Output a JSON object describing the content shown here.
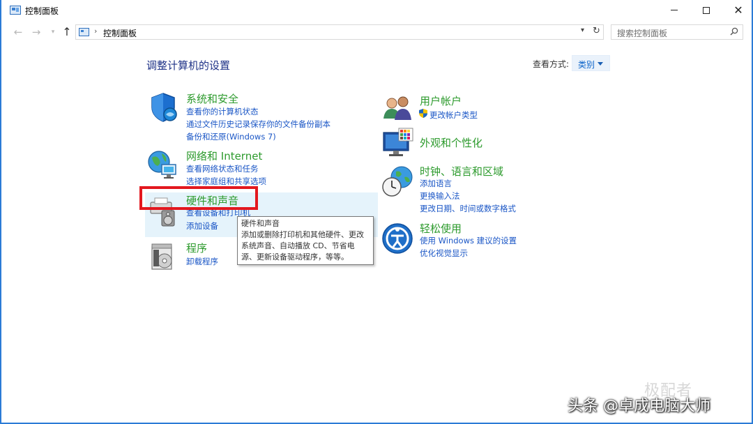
{
  "window": {
    "title": "控制面板",
    "minimize_label": "",
    "maximize_label": "",
    "close_label": "✕"
  },
  "nav": {
    "back_icon": "←",
    "forward_icon": "→",
    "recent_icon": "▾",
    "up_icon": "↑",
    "separator": "›",
    "address": "控制面板",
    "address_dropdown_icon": "▾",
    "refresh_icon": "↻",
    "search_placeholder": "搜索控制面板"
  },
  "main": {
    "heading": "调整计算机的设置",
    "view_by_label": "查看方式:",
    "view_by_value": "类别"
  },
  "categories_left": [
    {
      "title": "系统和安全",
      "icon": "shield-icon",
      "links": [
        "查看你的计算机状态",
        "通过文件历史记录保存你的文件备份副本",
        "备份和还原(Windows 7)"
      ]
    },
    {
      "title": "网络和 Internet",
      "icon": "network-globe-icon",
      "links": [
        "查看网络状态和任务",
        "选择家庭组和共享选项"
      ]
    },
    {
      "title": "硬件和声音",
      "icon": "printer-speaker-icon",
      "links": [
        "查看设备和打印机",
        "添加设备"
      ]
    },
    {
      "title": "程序",
      "icon": "programs-disc-icon",
      "links": [
        "卸载程序"
      ]
    }
  ],
  "categories_right": [
    {
      "title": "用户帐户",
      "icon": "users-icon",
      "links": [
        "更改帐户类型"
      ]
    },
    {
      "title": "外观和个性化",
      "icon": "monitor-palette-icon",
      "links": []
    },
    {
      "title": "时钟、语言和区域",
      "icon": "clock-globe-icon",
      "links": [
        "添加语言",
        "更换输入法",
        "更改日期、时间或数字格式"
      ]
    },
    {
      "title": "轻松使用",
      "icon": "ease-of-access-icon",
      "links": [
        "使用 Windows 建议的设置",
        "优化视觉显示"
      ]
    }
  ],
  "tooltip": {
    "lines": [
      "硬件和声音",
      "添加或删除打印机和其他硬件、更改",
      "系统声音、自动播放 CD、节省电",
      "源、更新设备驱动程序，等等。"
    ]
  },
  "watermarks": {
    "brand": "极配者",
    "caption": "头条 @卓成电脑大师"
  },
  "colors": {
    "category_title": "#2c9a2c",
    "link": "#1a56c6",
    "heading": "#1e3287",
    "highlight_box": "#e3171e",
    "hover_background": "#e5f3fb",
    "window_border": "#2b7bd6"
  }
}
